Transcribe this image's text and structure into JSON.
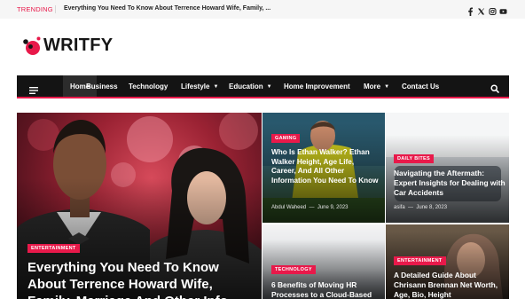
{
  "topbar": {
    "trending_label": "TRENDING",
    "trending_headline": "Everything You Need To Know About Terrence Howard Wife, Family, ...",
    "social_icons": [
      "facebook-icon",
      "twitter-icon",
      "instagram-icon",
      "youtube-icon"
    ]
  },
  "logo": {
    "text": "WRITFY"
  },
  "nav": {
    "items": [
      {
        "label": "Home",
        "dropdown": false
      },
      {
        "label": "Business",
        "dropdown": false
      },
      {
        "label": "Technology",
        "dropdown": false
      },
      {
        "label": "Lifestyle",
        "dropdown": true
      },
      {
        "label": "Education",
        "dropdown": true
      },
      {
        "label": "Home Improvement",
        "dropdown": false
      },
      {
        "label": "More",
        "dropdown": true
      },
      {
        "label": "Contact Us",
        "dropdown": false
      }
    ]
  },
  "articles": [
    {
      "category": "ENTERTAINMENT",
      "title": "Everything You Need To Know About Terrence Howard Wife, Family, Marriage And Other Info"
    },
    {
      "category": "GAMING",
      "title": "Who Is Ethan Walker? Ethan Walker Height, Age Life, Career, And All Other Information You Need To Know",
      "author": "Abdul Waheed",
      "date": "June 9, 2023"
    },
    {
      "category": "DAILY BITES",
      "title": "Navigating the Aftermath: Expert Insights for Dealing with Car Accidents",
      "author": "asifa",
      "date": "June 8, 2023"
    },
    {
      "category": "TECHNOLOGY",
      "title": "6 Benefits of Moving HR Processes to a Cloud-Based"
    },
    {
      "category": "ENTERTAINMENT",
      "title": "A Detailed Guide About Chrisann Brennan Net Worth, Age, Bio, Height"
    }
  ],
  "colors": {
    "accent": "#e8194a",
    "nav_bg": "#141414",
    "topbar_bg": "#f6f6f6"
  }
}
